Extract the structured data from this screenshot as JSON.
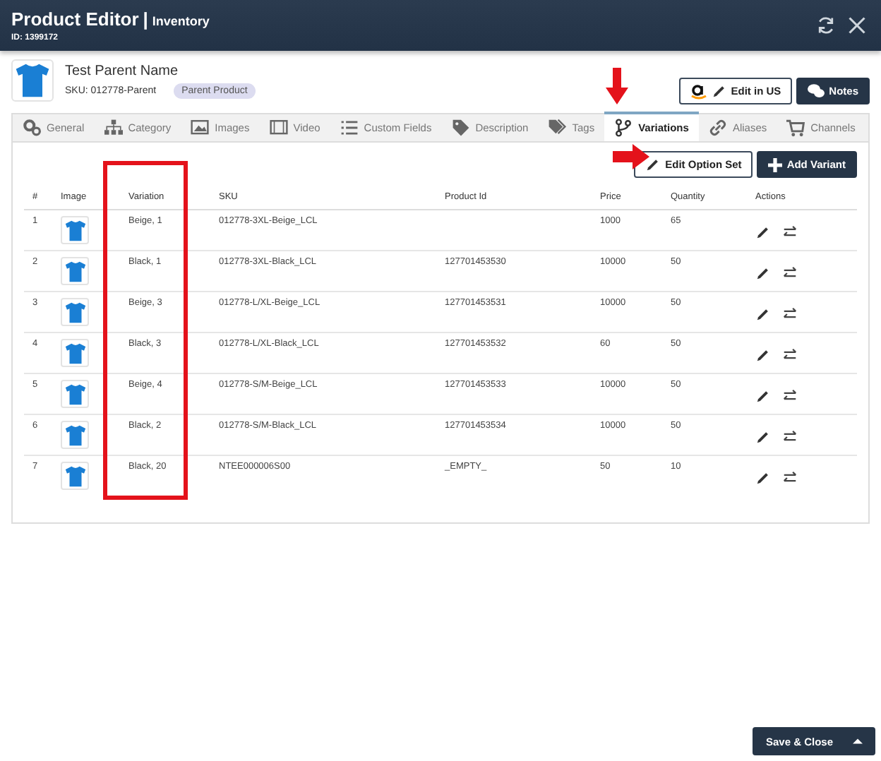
{
  "window": {
    "title": "Product Editor",
    "separator": "|",
    "subtitle": "Inventory",
    "id": "ID: 1399172"
  },
  "product": {
    "name": "Test Parent Name",
    "sku": "SKU: 012778-Parent",
    "badge": "Parent Product"
  },
  "header_buttons": [
    {
      "kind": "amazon",
      "label": "Edit in US"
    },
    {
      "kind": "notes",
      "label": "Notes"
    }
  ],
  "tabs": [
    {
      "label": "General",
      "selected": false
    },
    {
      "label": "Category",
      "selected": false
    },
    {
      "label": "Images",
      "selected": false
    },
    {
      "label": "Video",
      "selected": false
    },
    {
      "label": "Custom Fields",
      "selected": false
    },
    {
      "label": "Description",
      "selected": false
    },
    {
      "label": "Tags",
      "selected": false
    },
    {
      "label": "Variations",
      "selected": true
    },
    {
      "label": "Aliases",
      "selected": false
    },
    {
      "label": "Channels",
      "selected": false
    }
  ],
  "actions": [
    {
      "kind": "outline",
      "label": "Edit Option Set"
    },
    {
      "kind": "dark",
      "label": "Add Variant"
    }
  ],
  "table": {
    "columns": [
      "#",
      "Image",
      "Variation",
      "SKU",
      "Product Id",
      "Price",
      "Quantity",
      "Actions"
    ],
    "rows": [
      {
        "n": "1",
        "variation": "Beige, 1",
        "sku": "012778-3XL-Beige_LCL",
        "product_id": "",
        "price": "1000",
        "quantity": "65"
      },
      {
        "n": "2",
        "variation": "Black, 1",
        "sku": "012778-3XL-Black_LCL",
        "product_id": "127701453530",
        "price": "10000",
        "quantity": "50"
      },
      {
        "n": "3",
        "variation": "Beige, 3",
        "sku": "012778-L/XL-Beige_LCL",
        "product_id": "127701453531",
        "price": "10000",
        "quantity": "50"
      },
      {
        "n": "4",
        "variation": "Black, 3",
        "sku": "012778-L/XL-Black_LCL",
        "product_id": "127701453532",
        "price": "60",
        "quantity": "50"
      },
      {
        "n": "5",
        "variation": "Beige, 4",
        "sku": "012778-S/M-Beige_LCL",
        "product_id": "127701453533",
        "price": "10000",
        "quantity": "50"
      },
      {
        "n": "6",
        "variation": "Black, 2",
        "sku": "012778-S/M-Black_LCL",
        "product_id": "127701453534",
        "price": "10000",
        "quantity": "50"
      },
      {
        "n": "7",
        "variation": "Black, 20",
        "sku": "NTEE000006S00",
        "product_id": "_EMPTY_",
        "price": "50",
        "quantity": "10"
      }
    ]
  },
  "footer": {
    "button": "Save & Close"
  }
}
